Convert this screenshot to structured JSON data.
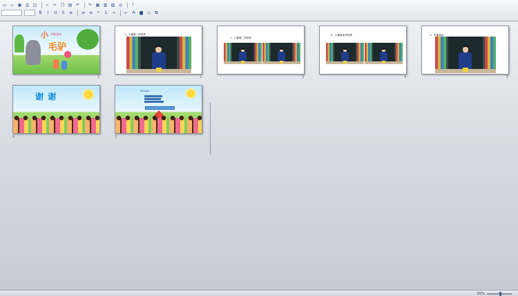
{
  "toolbar": {
    "row1": [
      "new-icon",
      "open-icon",
      "save-icon",
      "print-icon",
      "preview-icon",
      "spell-icon",
      "cut-icon",
      "copy-icon",
      "paste-icon",
      "undo-icon",
      "redo-icon",
      "table-icon",
      "chart-icon",
      "image-icon",
      "zoom-icon",
      "help-icon"
    ],
    "font_name": "",
    "font_size": "",
    "row2": [
      "bold-icon",
      "italic-icon",
      "underline-icon",
      "strike-icon",
      "align-left-icon",
      "align-center-icon",
      "align-right-icon",
      "bullets-icon",
      "numbering-icon",
      "indent-icon",
      "outdent-icon",
      "font-color-icon",
      "fill-color-icon",
      "shape-icon",
      "arrange-icon"
    ]
  },
  "slides": [
    {
      "num": "1",
      "style": "title",
      "title_char1": "小",
      "title_rest": "毛驴",
      "subtitle": "节奏游戏"
    },
    {
      "num": "2",
      "style": "photo",
      "heading": "1、小星星一声拍练",
      "photos": 1
    },
    {
      "num": "3",
      "style": "photo",
      "heading": "2、小星星二声拍练",
      "photos": 2
    },
    {
      "num": "4",
      "style": "photo",
      "heading": "3、小星星多声拍练",
      "photos": 2
    },
    {
      "num": "5",
      "style": "photo",
      "heading": "4、节奏游戏",
      "photos": 1
    },
    {
      "num": "6",
      "style": "thanks",
      "text": "谢 谢"
    },
    {
      "num": "7",
      "style": "review",
      "heading": "Whistle",
      "lines": [
        "",
        "",
        ""
      ]
    }
  ],
  "statusbar": {
    "left": "",
    "zoom_percent": "55%"
  }
}
